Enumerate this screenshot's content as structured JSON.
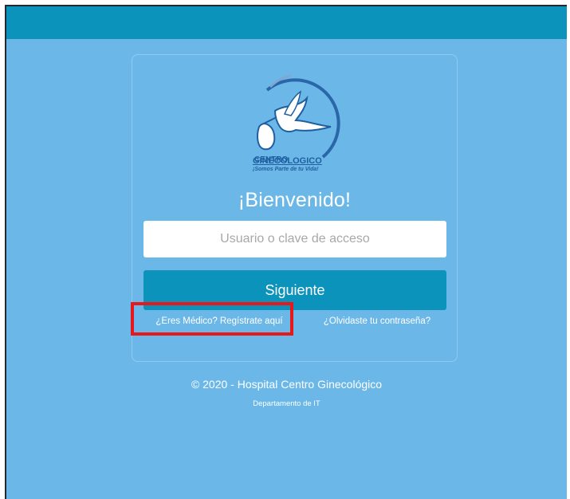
{
  "header": {},
  "logo": {
    "line1": "CENTRO",
    "line2": "GINECOLOGICO",
    "tagline": "¡Somos Parte de tu Vida!"
  },
  "login": {
    "welcome": "¡Bienvenido!",
    "input_placeholder": "Usuario o clave de acceso",
    "submit_label": "Siguiente",
    "register_link": "¿Eres Médico? Regístrate aquí",
    "forgot_link": "¿Olvidaste tu contraseña?"
  },
  "footer": {
    "copyright": "©  2020 -  Hospital Centro Ginecológico",
    "department": "Departamento de IT"
  },
  "colors": {
    "background": "#6bb8e8",
    "header_bar": "#0b93bb",
    "button": "#0b93bb",
    "highlight_box": "#e8171a",
    "logo_blue": "#1f5fa0"
  }
}
